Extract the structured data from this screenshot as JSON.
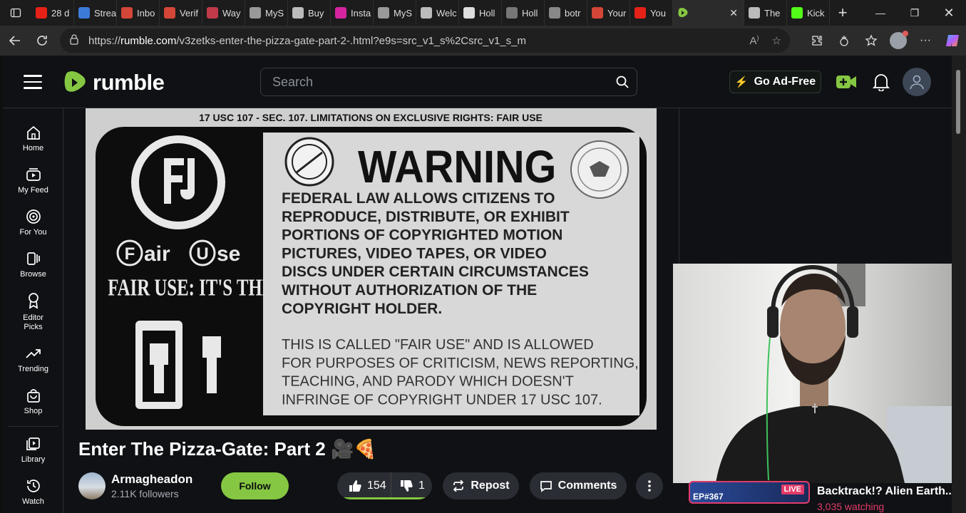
{
  "browser": {
    "tabs": [
      {
        "label": "28 d",
        "icon": "youtube-icon",
        "color": "#e62117"
      },
      {
        "label": "Strea",
        "icon": "air-icon",
        "color": "#3d7bd9"
      },
      {
        "label": "Inbo",
        "icon": "gmail-icon",
        "color": "#d44638"
      },
      {
        "label": "Verif",
        "icon": "gmail-icon",
        "color": "#d44638"
      },
      {
        "label": "Way",
        "icon": "mask-icon",
        "color": "#c03a4a"
      },
      {
        "label": "MyS",
        "icon": "globe-icon",
        "color": "#999999"
      },
      {
        "label": "Buy",
        "icon": "feather-icon",
        "color": "#bbbbbb"
      },
      {
        "label": "Insta",
        "icon": "instagram-icon",
        "color": "#d6249f"
      },
      {
        "label": "MyS",
        "icon": "globe-icon",
        "color": "#999999"
      },
      {
        "label": "Welc",
        "icon": "diamond-icon",
        "color": "#bbbbbb"
      },
      {
        "label": "Holl",
        "icon": "amazon-icon",
        "color": "#dddddd"
      },
      {
        "label": "Holl",
        "icon": "pw-icon",
        "color": "#777777"
      },
      {
        "label": "botr",
        "icon": "search-icon",
        "color": "#888888"
      },
      {
        "label": "Your",
        "icon": "gmail-icon",
        "color": "#d44638"
      },
      {
        "label": "You",
        "icon": "youtube-icon",
        "color": "#e62117"
      },
      {
        "label": "",
        "icon": "rumble-icon",
        "color": "#85c742",
        "active": true
      },
      {
        "label": "The",
        "icon": "diamond-icon",
        "color": "#bbbbbb"
      },
      {
        "label": "Kick",
        "icon": "kick-icon",
        "color": "#53fc18"
      }
    ],
    "url_scheme": "https://",
    "url_host": "rumble.com",
    "url_path": "/v3zetks-enter-the-pizza-gate-part-2-.html?e9s=src_v1_s%2Csrc_v1_s_m"
  },
  "header": {
    "logo_text": "rumble",
    "search_placeholder": "Search",
    "ad_free_label": "Go Ad-Free"
  },
  "sidebar": {
    "items": [
      {
        "label": "Home",
        "icon": "home-icon"
      },
      {
        "label": "My Feed",
        "icon": "feed-icon"
      },
      {
        "label": "For You",
        "icon": "target-icon"
      },
      {
        "label": "Browse",
        "icon": "browse-icon"
      },
      {
        "label": "Editor Picks",
        "icon": "award-icon"
      },
      {
        "label": "Trending",
        "icon": "trending-icon"
      },
      {
        "label": "Shop",
        "icon": "shop-icon"
      },
      {
        "label": "Library",
        "icon": "library-icon"
      },
      {
        "label": "Watch",
        "icon": "history-icon"
      }
    ]
  },
  "video": {
    "frame": {
      "top_line": "17 USC 107 - SEC. 107. LIMITATIONS ON EXCLUSIVE RIGHTS: FAIR USE",
      "heading": "WARNING",
      "body_lines": [
        "FEDERAL LAW ALLOWS CITIZENS TO",
        "REPRODUCE, DISTRIBUTE, OR EXHIBIT",
        "PORTIONS OF COPYRIGHTED MOTION",
        "PICTURES, VIDEO TAPES, OR VIDEO",
        "DISCS UNDER CERTAIN CIRCUMSTANCES",
        "WITHOUT AUTHORIZATION OF THE",
        "COPYRIGHT HOLDER."
      ],
      "fine_lines": [
        "THIS IS CALLED \"FAIR USE\" AND IS ALLOWED",
        "FOR PURPOSES OF CRITICISM, NEWS REPORTING,",
        "TEACHING, AND PARODY WHICH DOESN'T",
        "INFRINGE OF COPYRIGHT UNDER 17 USC 107."
      ],
      "fair_use_logo_letter_1": "F",
      "fair_use_logo_word_1": "air",
      "fair_use_logo_letter_2": "U",
      "fair_use_logo_word_2": "se",
      "law_line": "FAIR USE: IT'S THE LAW"
    },
    "title": "Enter The Pizza-Gate: Part 2 🎥🍕",
    "channel_name": "Armagheadon",
    "followers": "2.11K followers",
    "follow_label": "Follow",
    "upvotes": "154",
    "downvotes": "1",
    "vote_ratio": 0.99,
    "repost_label": "Repost",
    "comments_label": "Comments"
  },
  "related": {
    "live_badge": "LIVE",
    "episode": "EP#367",
    "title": "Backtrack!? Alien Earth...",
    "watching": "3,035 watching"
  },
  "colors": {
    "brand": "#85c742",
    "live": "#e23b6a"
  }
}
